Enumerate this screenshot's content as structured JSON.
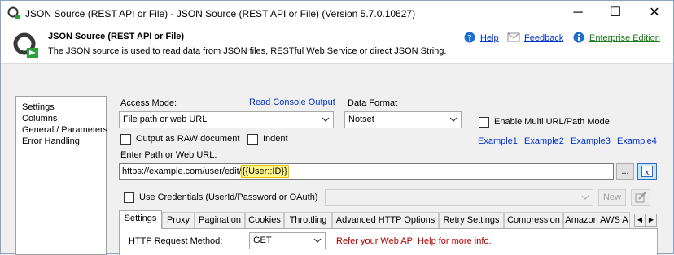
{
  "window": {
    "title": "JSON Source (REST API or File) - JSON Source (REST API or File) (Version 5.7.0.10627)",
    "minimize": "─",
    "maximize": "☐",
    "close": "✕"
  },
  "header": {
    "title": "JSON Source (REST API or File)",
    "description": "The JSON source is used to read data from JSON files, RESTful Web Service or direct JSON String.",
    "help": "Help",
    "feedback": "Feedback",
    "edition": "Enterprise Edition"
  },
  "sidebar": {
    "items": [
      "Settings",
      "Columns",
      "General / Parameters",
      "Error Handling"
    ]
  },
  "form": {
    "access_mode_label": "Access Mode:",
    "read_console_output": "Read Console Output",
    "access_mode_value": "File path or web URL",
    "data_format_label": "Data Format",
    "data_format_value": "Notset",
    "enable_multi_url": "Enable Multi URL/Path Mode",
    "output_raw": "Output as RAW document",
    "indent": "Indent",
    "examples": [
      "Example1",
      "Example2",
      "Example3",
      "Example4"
    ],
    "path_label": "Enter Path or Web URL:",
    "url_prefix": "https://example.com/user/edit/",
    "url_highlight": "{{User::ID}}",
    "browse_button": "...",
    "use_credentials": "Use Credentials (UserId/Password or OAuth)",
    "new_button": "New"
  },
  "tabs": [
    "Settings",
    "Proxy",
    "Pagination",
    "Cookies",
    "Throttling",
    "Advanced HTTP Options",
    "Retry Settings",
    "Compression",
    "Amazon AWS A"
  ],
  "settings": {
    "method_label": "HTTP Request Method:",
    "method_value": "GET",
    "hint": "Refer your Web API Help for more info."
  },
  "colors": {
    "link": "#0033cc",
    "edition": "#1a7a1a",
    "hint": "#b30000",
    "highlight": "#fff58a"
  }
}
